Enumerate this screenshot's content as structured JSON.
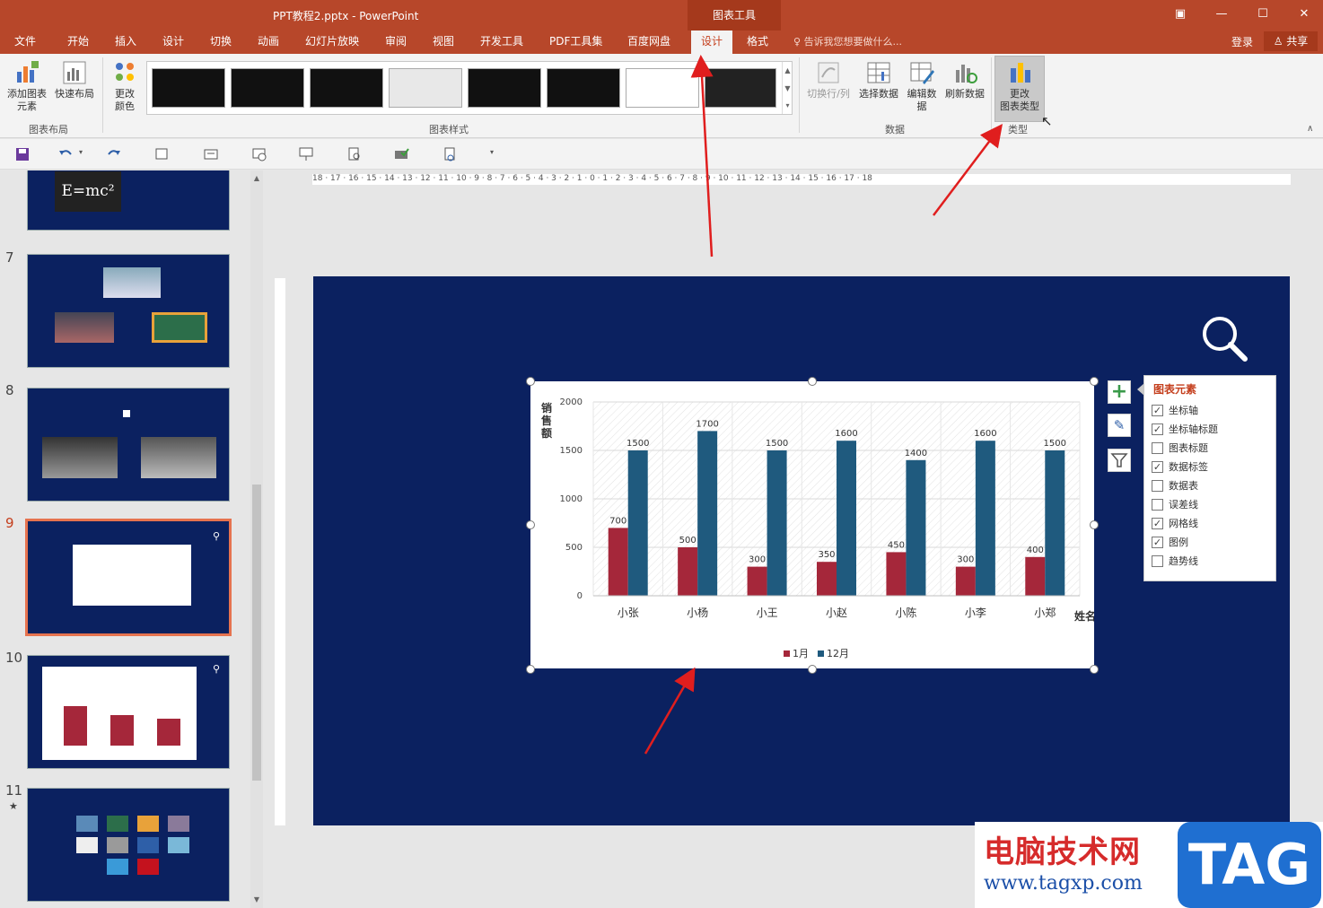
{
  "window": {
    "doc_title": "PPT教程2.pptx - PowerPoint",
    "context_tab_group": "图表工具"
  },
  "tabs": [
    {
      "label": "文件",
      "name": "tab-file"
    },
    {
      "label": "开始",
      "name": "tab-home"
    },
    {
      "label": "插入",
      "name": "tab-insert"
    },
    {
      "label": "设计",
      "name": "tab-design"
    },
    {
      "label": "切换",
      "name": "tab-transitions"
    },
    {
      "label": "动画",
      "name": "tab-animations"
    },
    {
      "label": "幻灯片放映",
      "name": "tab-slideshow"
    },
    {
      "label": "审阅",
      "name": "tab-review"
    },
    {
      "label": "视图",
      "name": "tab-view"
    },
    {
      "label": "开发工具",
      "name": "tab-developer"
    },
    {
      "label": "PDF工具集",
      "name": "tab-pdf"
    },
    {
      "label": "百度网盘",
      "name": "tab-baidu"
    },
    {
      "label": "设计",
      "name": "tab-chart-design"
    },
    {
      "label": "格式",
      "name": "tab-chart-format"
    }
  ],
  "tell_me": "告诉我您想要做什么...",
  "signin": "登录",
  "share": "共享",
  "ribbon": {
    "add_element": "添加图表\n元素",
    "quick_layout": "快速布局",
    "change_colors": "更改\n颜色",
    "group_layout": "图表布局",
    "group_styles": "图表样式",
    "switch_row_col": "切换行/列",
    "select_data": "选择数据",
    "edit_data": "编辑数\n据",
    "refresh_data": "刷新数据",
    "group_data": "数据",
    "change_type": "更改\n图表类型",
    "group_type": "类型"
  },
  "slides": [
    {
      "num": "7"
    },
    {
      "num": "8"
    },
    {
      "num": "9"
    },
    {
      "num": "10"
    },
    {
      "num": "11"
    }
  ],
  "slide6_formula": "E=mc²",
  "ruler_h": "18 · 17 · 16 · 15 · 14 · 13 · 12 · 11 · 10 · 9 · 8 · 7 · 6 · 5 · 4 · 3 · 2 · 1 · 0 · 1 · 2 · 3 · 4 · 5 · 6 · 7 · 8 · 9 · 10 · 11 · 12 · 13 · 14 · 15 · 16 · 17 · 18",
  "chart_data": {
    "type": "bar",
    "categories": [
      "小张",
      "小杨",
      "小王",
      "小赵",
      "小陈",
      "小李",
      "小郑"
    ],
    "series": [
      {
        "name": "1月",
        "values": [
          700,
          500,
          300,
          350,
          450,
          300,
          400
        ],
        "color": "#a5273a"
      },
      {
        "name": "12月",
        "values": [
          1500,
          1700,
          1500,
          1600,
          1400,
          1600,
          1500
        ],
        "color": "#1f5a7e"
      }
    ],
    "ylabel": "销售额",
    "xlabel": "姓名",
    "yticks": [
      "0",
      "500",
      "1000",
      "1500",
      "2000"
    ],
    "ylim": [
      0,
      2000
    ],
    "grid": true,
    "legend": "bottom"
  },
  "elements_panel": {
    "title": "图表元素",
    "items": [
      {
        "label": "坐标轴",
        "checked": true
      },
      {
        "label": "坐标轴标题",
        "checked": true
      },
      {
        "label": "图表标题",
        "checked": false
      },
      {
        "label": "数据标签",
        "checked": true
      },
      {
        "label": "数据表",
        "checked": false
      },
      {
        "label": "误差线",
        "checked": false
      },
      {
        "label": "网格线",
        "checked": true
      },
      {
        "label": "图例",
        "checked": true
      },
      {
        "label": "趋势线",
        "checked": false
      }
    ]
  },
  "watermark": {
    "text": "电脑技术网",
    "url": "www.tagxp.com",
    "tag": "TAG"
  },
  "colors": {
    "accent": "#b7472a",
    "slide_bg": "#0b2160"
  }
}
